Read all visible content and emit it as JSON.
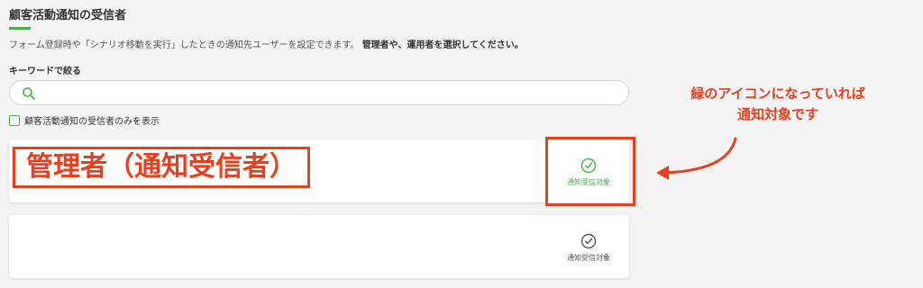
{
  "section": {
    "title": "顧客活動通知の受信者",
    "description_normal": "フォーム登録時や「シナリオ移動を実行」したときの通知先ユーザーを設定できます。",
    "description_bold": "管理者や、運用者を選択してください。"
  },
  "search": {
    "label": "キーワードで絞る",
    "placeholder": "",
    "value": ""
  },
  "filter": {
    "label": "顧客活動通知の受信者のみを表示",
    "checked": false
  },
  "users": [
    {
      "name": "管理者（通知受信者）",
      "recipient_label": "通知受信対象",
      "recipient": true
    },
    {
      "name": "",
      "recipient_label": "通知受信対象",
      "recipient": false
    }
  ],
  "annotation": {
    "line1": "緑のアイコンになっていれば",
    "line2": "通知対象です"
  },
  "colors": {
    "accent_green": "#4caf50",
    "annotation_red": "#e8401f",
    "icon_gray": "#555555"
  }
}
